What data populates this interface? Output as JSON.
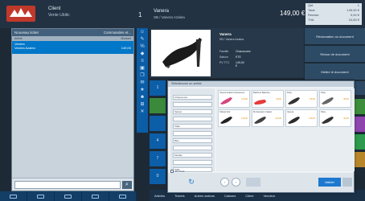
{
  "header": {
    "user": "Client",
    "store": "Vente Ubitic",
    "ticket_num": "1",
    "title": "Vanera",
    "subtitle": "SB / Vanera Azalea",
    "total": "149,00 €",
    "summary": [
      {
        "label": "Qté",
        "value": "1"
      },
      {
        "label": "Total",
        "value": "149,00 €"
      },
      {
        "label": "Remise",
        "value": "0,00 €"
      },
      {
        "label": "TVA",
        "value": "24,83 €"
      }
    ]
  },
  "ticket": {
    "header_left": "Nouveau ticket",
    "header_right": "Commandes et...",
    "col_left": "Article",
    "col_right": "Montant",
    "line_name": "Vanera",
    "line_sub": "Vanera Azalea",
    "line_amount": "149,00",
    "scan_placeholder": ""
  },
  "product": {
    "name": "Vanera",
    "sub": "SB / Vanera Azalea",
    "specs": [
      {
        "label": "Famille",
        "value": "Chaussures"
      },
      {
        "label": "Saison",
        "value": "ETE"
      },
      {
        "label": "PV TTC",
        "value": "149,00 €"
      }
    ]
  },
  "right_actions": [
    "Réclamation ou document",
    "Retour de document",
    "Mettre le document",
    ""
  ],
  "tiles": [
    "1",
    "4",
    "7",
    ",",
    "0"
  ],
  "bottom_toolbar": [
    "Articles",
    "Tickets",
    "Autres actions",
    "Caisses",
    "Client",
    "Vendeur"
  ],
  "dialog": {
    "title": "Sélectionner un article",
    "fields": [
      {
        "label": "",
        "value": "Chaussures"
      },
      {
        "label": "",
        "value": ""
      },
      {
        "label": "",
        "value": "Saison"
      },
      {
        "label": "",
        "value": ""
      },
      {
        "label": "",
        "value": "Taille"
      },
      {
        "label": "",
        "value": ""
      },
      {
        "label": "",
        "value": "Bleu"
      },
      {
        "label": "",
        "value": ""
      },
      {
        "label": "",
        "value": "Modèle"
      },
      {
        "label": "",
        "value": ""
      },
      {
        "label": "",
        "value": "Taille"
      }
    ],
    "checkbox_label": "En stock",
    "cards": [
      {
        "name": "Vanera Azalea Chaussures",
        "price": "149,00",
        "color": "#d4477e"
      },
      {
        "name": "Ballerine Balerina...",
        "price": "99,00",
        "color": "#e63b3b"
      },
      {
        "name": "Patty",
        "price": "89,00",
        "color": "#333333"
      },
      {
        "name": "Patty",
        "price": "89,00",
        "color": "#666666"
      },
      {
        "name": "Stiletto Noir",
        "price": "129,00",
        "color": "#222222"
      },
      {
        "name": "Mc Escarpin Classic",
        "price": "119,00",
        "color": "#404040"
      },
      {
        "name": "Vanera",
        "price": "149,00",
        "color": "#2b2b2b"
      },
      {
        "name": "Patty",
        "price": "89,00",
        "color": "#333333"
      }
    ],
    "ok_label": "Valider"
  }
}
